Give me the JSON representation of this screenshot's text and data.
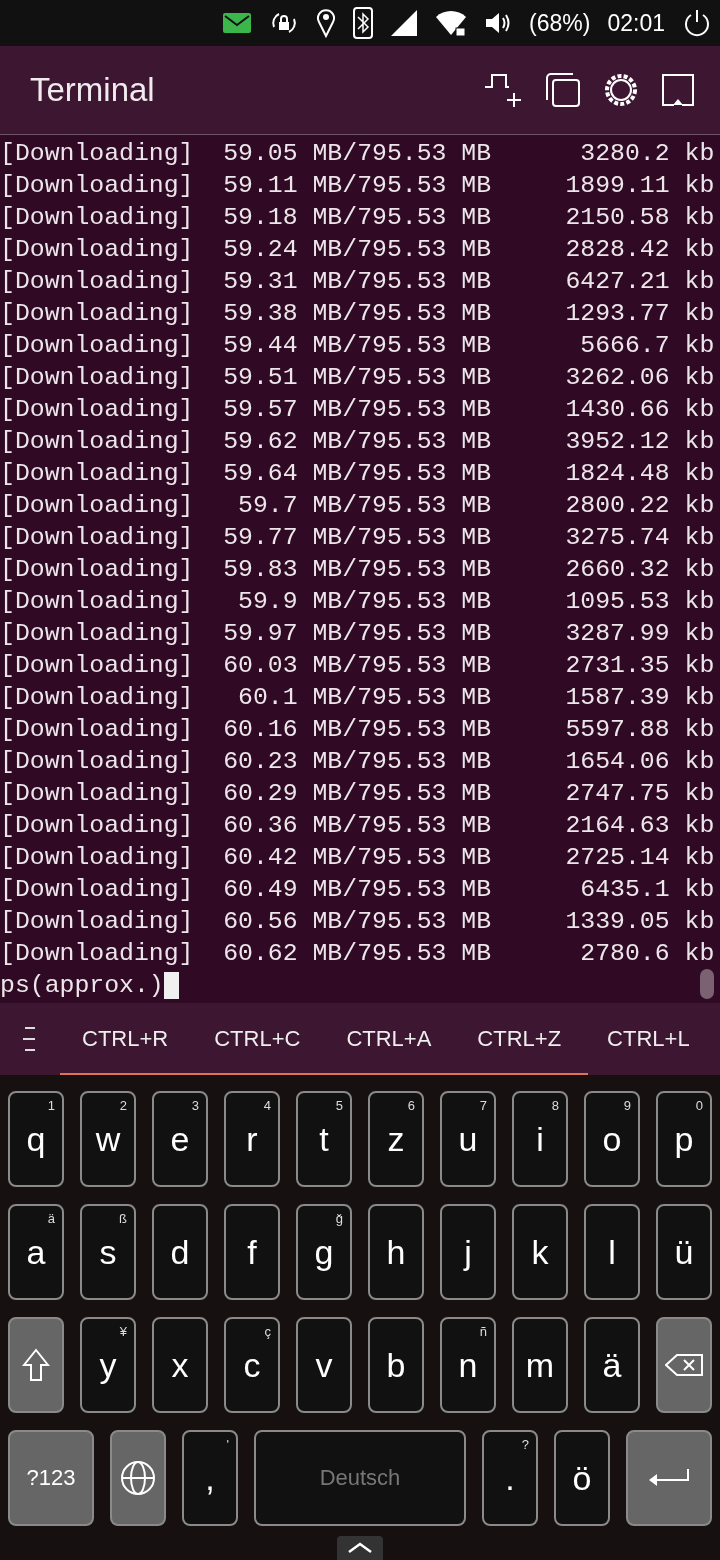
{
  "status_bar": {
    "battery": "(68%)",
    "time": "02:01"
  },
  "header": {
    "title": "Terminal"
  },
  "terminal": {
    "lines": [
      "[Downloading]  59.05 MB/795.53 MB      3280.2 kb",
      "[Downloading]  59.11 MB/795.53 MB     1899.11 kb",
      "[Downloading]  59.18 MB/795.53 MB     2150.58 kb",
      "[Downloading]  59.24 MB/795.53 MB     2828.42 kb",
      "[Downloading]  59.31 MB/795.53 MB     6427.21 kb",
      "[Downloading]  59.38 MB/795.53 MB     1293.77 kb",
      "[Downloading]  59.44 MB/795.53 MB      5666.7 kb",
      "[Downloading]  59.51 MB/795.53 MB     3262.06 kb",
      "[Downloading]  59.57 MB/795.53 MB     1430.66 kb",
      "[Downloading]  59.62 MB/795.53 MB     3952.12 kb",
      "[Downloading]  59.64 MB/795.53 MB     1824.48 kb",
      "[Downloading]   59.7 MB/795.53 MB     2800.22 kb",
      "[Downloading]  59.77 MB/795.53 MB     3275.74 kb",
      "[Downloading]  59.83 MB/795.53 MB     2660.32 kb",
      "[Downloading]   59.9 MB/795.53 MB     1095.53 kb",
      "[Downloading]  59.97 MB/795.53 MB     3287.99 kb",
      "[Downloading]  60.03 MB/795.53 MB     2731.35 kb",
      "[Downloading]   60.1 MB/795.53 MB     1587.39 kb",
      "[Downloading]  60.16 MB/795.53 MB     5597.88 kb",
      "[Downloading]  60.23 MB/795.53 MB     1654.06 kb",
      "[Downloading]  60.29 MB/795.53 MB     2747.75 kb",
      "[Downloading]  60.36 MB/795.53 MB     2164.63 kb",
      "[Downloading]  60.42 MB/795.53 MB     2725.14 kb",
      "[Downloading]  60.49 MB/795.53 MB      6435.1 kb",
      "[Downloading]  60.56 MB/795.53 MB     1339.05 kb",
      "[Downloading]  60.62 MB/795.53 MB      2780.6 kb",
      "ps(approx.)"
    ]
  },
  "shortcuts": [
    "CTRL+R",
    "CTRL+C",
    "CTRL+A",
    "CTRL+Z",
    "CTRL+L"
  ],
  "keyboard": {
    "letter_rows": [
      [
        {
          "kind": "char",
          "label": "q",
          "hint": "1"
        },
        {
          "kind": "char",
          "label": "w",
          "hint": "2"
        },
        {
          "kind": "char",
          "label": "e",
          "hint": "3"
        },
        {
          "kind": "char",
          "label": "r",
          "hint": "4"
        },
        {
          "kind": "char",
          "label": "t",
          "hint": "5"
        },
        {
          "kind": "char",
          "label": "z",
          "hint": "6"
        },
        {
          "kind": "char",
          "label": "u",
          "hint": "7"
        },
        {
          "kind": "char",
          "label": "i",
          "hint": "8"
        },
        {
          "kind": "char",
          "label": "o",
          "hint": "9"
        },
        {
          "kind": "char",
          "label": "p",
          "hint": "0"
        }
      ],
      [
        {
          "kind": "char",
          "label": "a",
          "hint": "ä"
        },
        {
          "kind": "char",
          "label": "s",
          "hint": "ß"
        },
        {
          "kind": "char",
          "label": "d"
        },
        {
          "kind": "char",
          "label": "f"
        },
        {
          "kind": "char",
          "label": "g",
          "hint": "ğ"
        },
        {
          "kind": "char",
          "label": "h"
        },
        {
          "kind": "char",
          "label": "j"
        },
        {
          "kind": "char",
          "label": "k"
        },
        {
          "kind": "char",
          "label": "l"
        },
        {
          "kind": "char",
          "label": "ü"
        }
      ],
      [
        {
          "kind": "shift"
        },
        {
          "kind": "char",
          "label": "y",
          "hint": "¥"
        },
        {
          "kind": "char",
          "label": "x"
        },
        {
          "kind": "char",
          "label": "c",
          "hint": "ç"
        },
        {
          "kind": "char",
          "label": "v"
        },
        {
          "kind": "char",
          "label": "b"
        },
        {
          "kind": "char",
          "label": "n",
          "hint": "ñ"
        },
        {
          "kind": "char",
          "label": "m"
        },
        {
          "kind": "char",
          "label": "ä"
        },
        {
          "kind": "backspace"
        }
      ]
    ],
    "bottom_row": [
      {
        "kind": "symbols",
        "label": "?123"
      },
      {
        "kind": "globe"
      },
      {
        "kind": "char",
        "label": ",",
        "hint": "'"
      },
      {
        "kind": "space",
        "label": "Deutsch"
      },
      {
        "kind": "char",
        "label": ".",
        "hint": "?"
      },
      {
        "kind": "char",
        "label": "ö"
      },
      {
        "kind": "enter"
      }
    ]
  }
}
